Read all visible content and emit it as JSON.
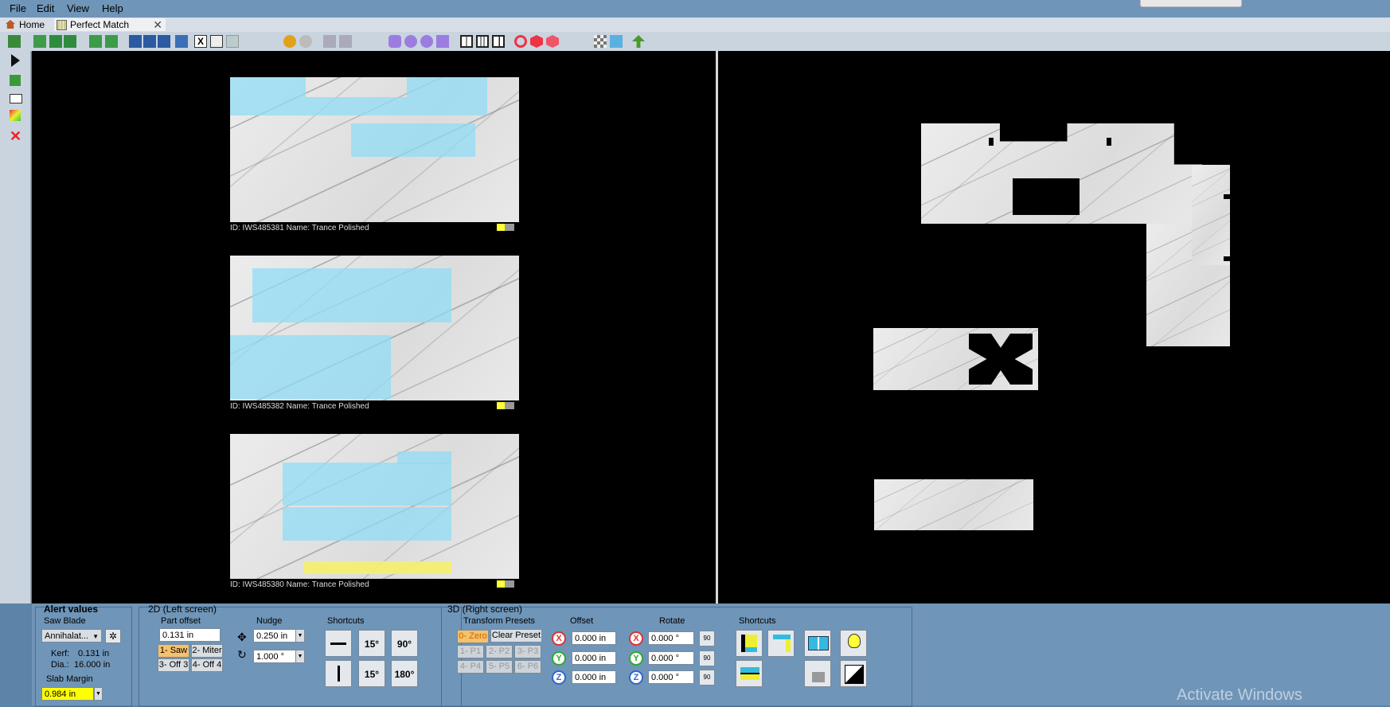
{
  "menu": {
    "file": "File",
    "edit": "Edit",
    "view": "View",
    "help": "Help"
  },
  "tabs": {
    "home": "Home",
    "perfect_match": "Perfect Match"
  },
  "slabs": [
    {
      "caption": "ID: IWS485381 Name: Trance Polished"
    },
    {
      "caption": "ID: IWS485382 Name: Trance Polished"
    },
    {
      "caption": "ID: IWS485380 Name: Trance Polished"
    }
  ],
  "alert": {
    "title": "Alert values",
    "saw_blade_label": "Saw Blade",
    "saw_blade_value": "Annihalat...",
    "kerf_label": "Kerf:",
    "kerf_value": "0.131 in",
    "dia_label": "Dia.:",
    "dia_value": "16.000 in",
    "slab_margin_label": "Slab Margin",
    "slab_margin_value": "0.984 in"
  },
  "left2d": {
    "title": "2D (Left screen)",
    "part_offset_label": "Part offset",
    "part_offset_value": "0.131 in",
    "btn_saw": "1- Saw",
    "btn_miter": "2- Miter",
    "btn_off3": "3- Off 3",
    "btn_off4": "4- Off 4",
    "nudge_label": "Nudge",
    "nudge_move": "0.250 in",
    "nudge_rotate": "1.000 °",
    "shortcuts_label": "Shortcuts",
    "rot15": "15°",
    "rot90": "90°",
    "rot15b": "15°",
    "rot180": "180°"
  },
  "right3d": {
    "title": "3D (Right screen)",
    "presets_label": "Transform Presets",
    "zero": "0- Zero",
    "clear": "Clear Preset",
    "p1": "1- P1",
    "p2": "2- P2",
    "p3": "3- P3",
    "p4": "4- P4",
    "p5": "5- P5",
    "p6": "6- P6",
    "offset_label": "Offset",
    "offset_x": "0.000 in",
    "offset_y": "0.000 in",
    "offset_z": "0.000 in",
    "rotate_label": "Rotate",
    "rotate_x": "0.000 °",
    "rotate_y": "0.000 °",
    "rotate_z": "0.000 °",
    "axis_x": "X",
    "axis_y": "Y",
    "axis_z": "Z",
    "small90": "90",
    "shortcuts_label": "Shortcuts"
  },
  "watermark": "Activate Windows",
  "colors": {
    "part_highlight": "#8cdcf5",
    "slab_margin_field": "#ffff00",
    "active_button": "#f5c16b"
  }
}
